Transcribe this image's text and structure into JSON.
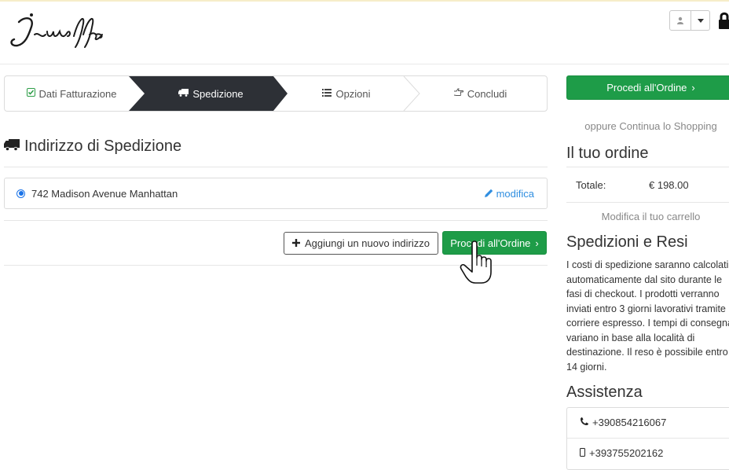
{
  "header": {
    "logo_text": "Jeunesse",
    "user_icon": "user-icon",
    "caret_icon": "caret-down-icon",
    "lock_icon": "lock-icon"
  },
  "steps": [
    {
      "label": "Dati Fatturazione",
      "icon": "check-square-icon",
      "state": "done"
    },
    {
      "label": "Spedizione",
      "icon": "truck-icon",
      "state": "active"
    },
    {
      "label": "Opzioni",
      "icon": "list-icon",
      "state": "pending"
    },
    {
      "label": "Concludi",
      "icon": "hand-point-icon",
      "state": "pending"
    }
  ],
  "shipping": {
    "title": "Indirizzo di Spedizione",
    "address": "742 Madison Avenue Manhattan",
    "edit_label": "modifica",
    "add_address_label": "Aggiungi un nuovo indirizzo",
    "proceed_label": "Procedi all'Ordine"
  },
  "sidebar": {
    "proceed_label": "Procedi all'Ordine",
    "continue_shopping": "oppure Continua lo Shopping",
    "order_title": "Il tuo ordine",
    "total_label": "Totale:",
    "total_value": "€ 198.00",
    "modify_cart": "Modifica il tuo carrello",
    "shipping_title": "Spedizioni e Resi",
    "shipping_text": "I costi di spedizione saranno calcolati automaticamente dal sito durante le fasi di checkout. I prodotti verranno inviati entro 3 giorni lavorativi tramite corriere espresso. I tempi di consegna variano in base alla località di destinazione. Il reso è possibile entro 14 giorni.",
    "assist_title": "Assistenza",
    "phones": [
      "+390854216067",
      "+393755202162"
    ]
  },
  "colors": {
    "accent_green": "#1e9c48",
    "active_step": "#2d3036",
    "link_blue": "#2f8ee0"
  }
}
